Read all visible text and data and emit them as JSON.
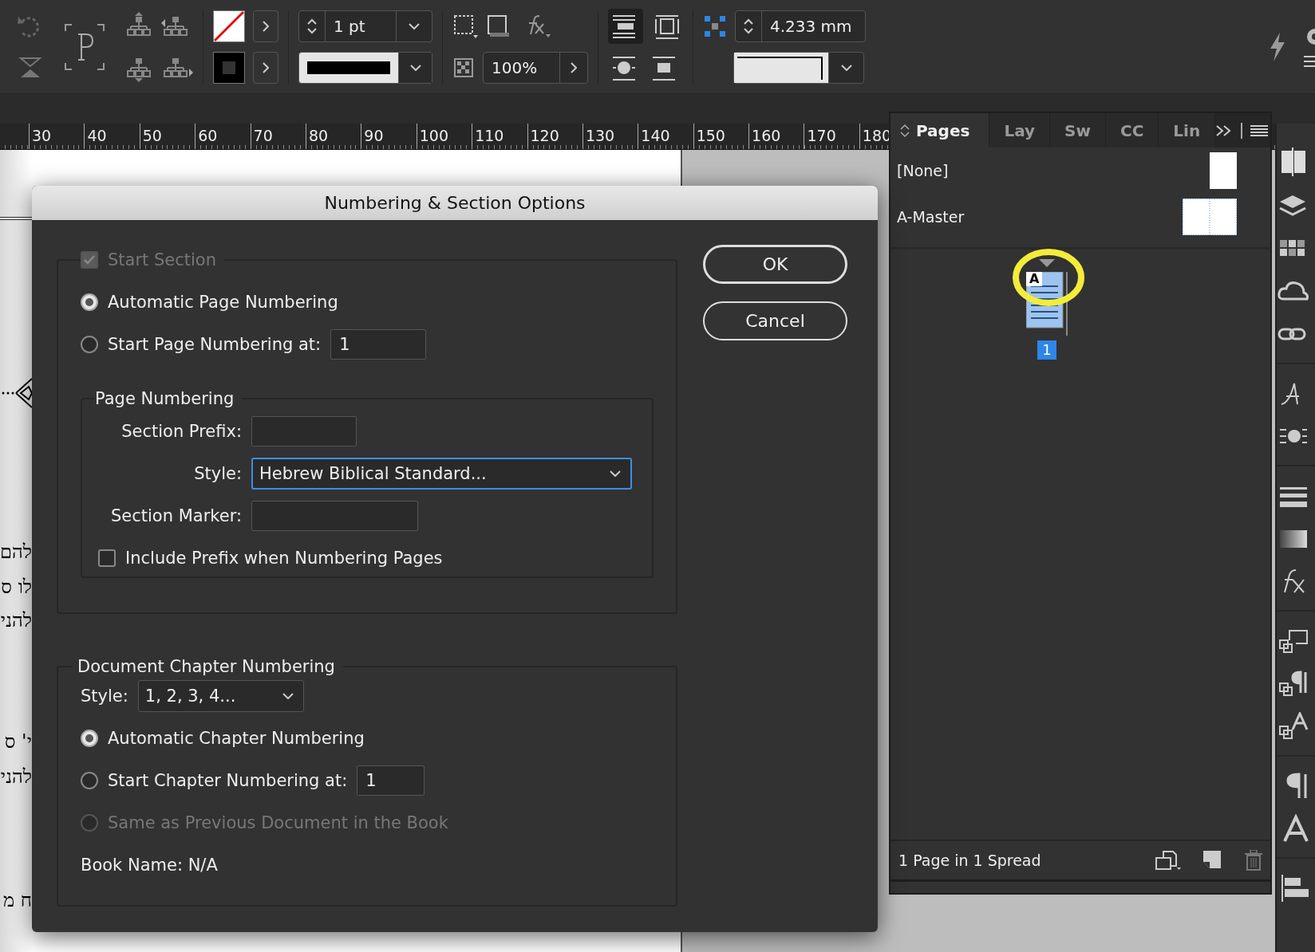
{
  "toolbar": {
    "stroke_weight": "1 pt",
    "opacity": "100%",
    "wrap_offset": "4.233 mm"
  },
  "ruler": {
    "labels": [
      "30",
      "40",
      "50",
      "60",
      "70",
      "80",
      "90",
      "100",
      "110",
      "120",
      "130",
      "140",
      "150",
      "160",
      "170",
      "180"
    ]
  },
  "document": {
    "text_fragments": [
      "להם",
      "לו ס",
      "להני",
      "י' ס",
      "להני",
      "ח מ"
    ]
  },
  "dialog": {
    "title": "Numbering & Section Options",
    "start_section": {
      "label": "Start Section",
      "checked": true,
      "disabled": true
    },
    "page_options": [
      {
        "label": "Automatic Page Numbering",
        "selected": true
      },
      {
        "label": "Start Page Numbering at:",
        "selected": false,
        "value": "1"
      }
    ],
    "page_numbering": {
      "legend": "Page Numbering",
      "prefix_label": "Section Prefix:",
      "style_label": "Style:",
      "style_value": "Hebrew Biblical Standard...",
      "style_focused": true,
      "marker_label": "Section Marker:",
      "include_prefix": {
        "label": "Include Prefix when Numbering Pages",
        "checked": false
      }
    },
    "chapter_numbering": {
      "legend": "Document Chapter Numbering",
      "style_label": "Style:",
      "style_value": "1, 2, 3, 4...",
      "options": [
        {
          "label": "Automatic Chapter Numbering",
          "selected": true,
          "disabled": false
        },
        {
          "label": "Start Chapter Numbering at:",
          "selected": false,
          "disabled": false,
          "value": "1"
        },
        {
          "label": "Same as Previous Document in the Book",
          "selected": false,
          "disabled": true
        }
      ],
      "book_name": "Book Name: N/A"
    },
    "buttons": [
      {
        "label": "OK",
        "kind": "default"
      },
      {
        "label": "Cancel",
        "kind": "normal"
      }
    ]
  },
  "pages_panel": {
    "tabs": [
      {
        "label": "Pages",
        "selected": true
      },
      {
        "label": "Lay",
        "selected": false
      },
      {
        "label": "Sw",
        "selected": false
      },
      {
        "label": "CC",
        "selected": false
      },
      {
        "label": "Lin",
        "selected": false
      }
    ],
    "masters": [
      {
        "name": "[None]",
        "kind": "single"
      },
      {
        "name": "A-Master",
        "kind": "spread"
      }
    ],
    "pages": [
      {
        "number": "1",
        "master": "A",
        "selected": true,
        "highlighted": true
      }
    ],
    "status": "1 Page in 1 Spread"
  }
}
